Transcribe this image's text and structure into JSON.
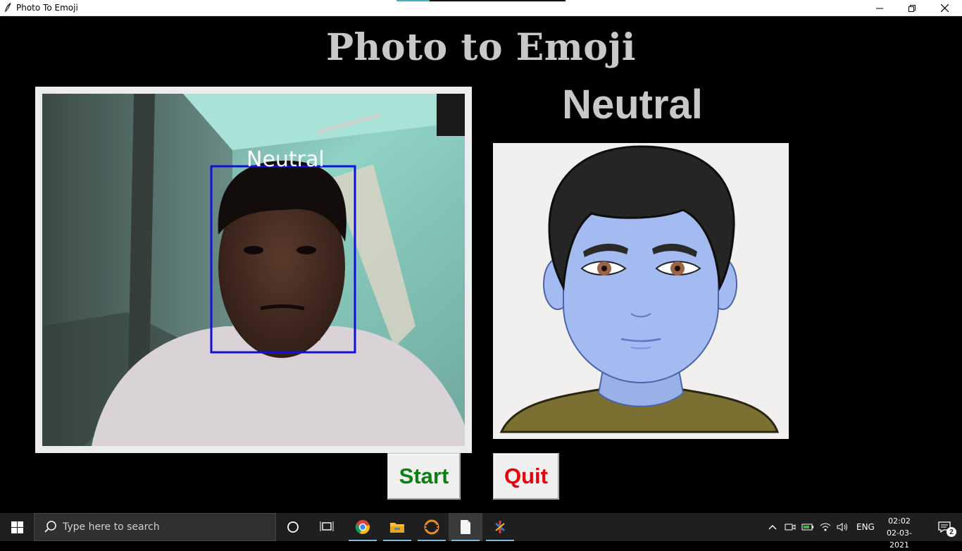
{
  "window": {
    "title": "Photo To Emoji",
    "controls": {
      "minimize": "minimize-icon",
      "restore": "restore-icon",
      "close": "close-icon"
    }
  },
  "app": {
    "heading": "Photo to Emoji",
    "camera": {
      "overlay_label": "Neutral",
      "box_color": "#1010d8"
    },
    "emotion": {
      "label": "Neutral"
    },
    "buttons": {
      "start": "Start",
      "quit": "Quit"
    },
    "colors": {
      "start_text": "#0a7f12",
      "quit_text": "#e8000a",
      "heading_text": "#c8c8c8"
    }
  },
  "taskbar": {
    "search_placeholder": "Type here to search",
    "apps": [
      "cortana-icon",
      "task-view-icon",
      "chrome-icon",
      "file-explorer-icon",
      "eclipse-icon",
      "notepad-icon",
      "python-app-icon"
    ],
    "tray": {
      "language": "ENG",
      "time": "02:02",
      "date": "02-03-2021",
      "notifications": "2"
    }
  }
}
